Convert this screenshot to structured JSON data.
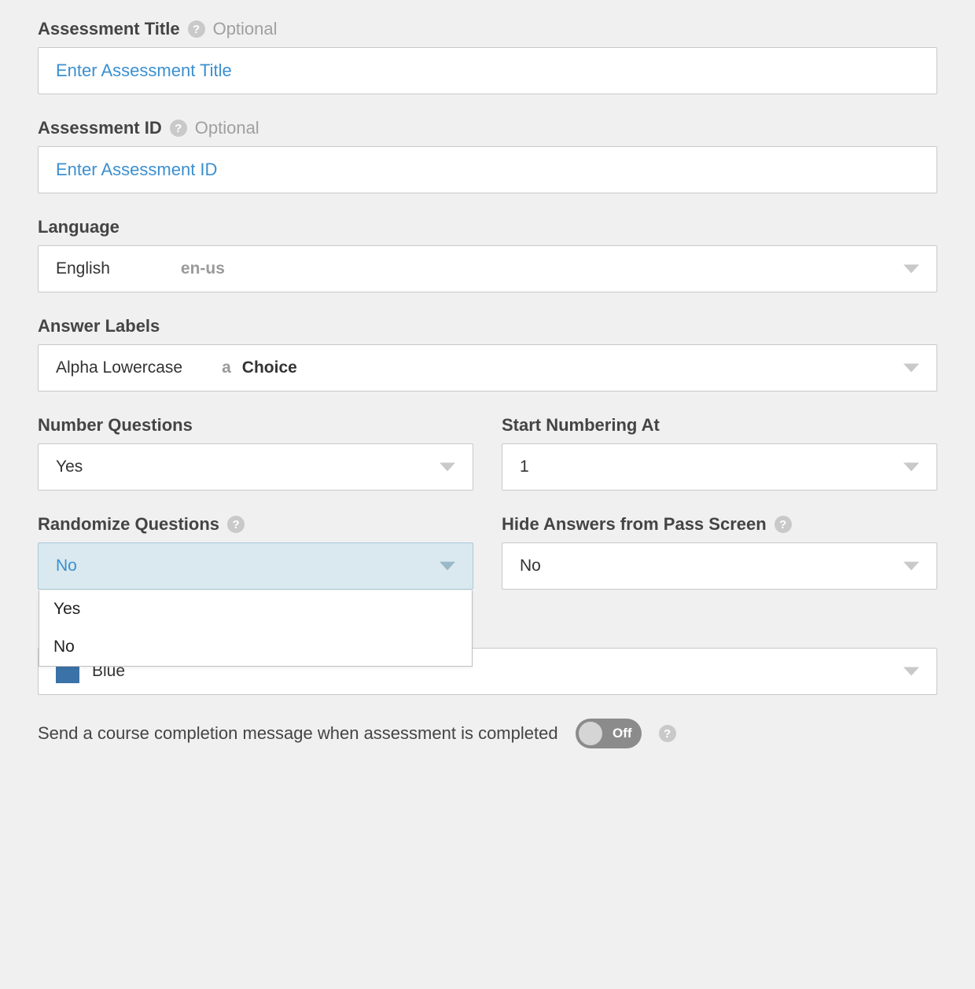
{
  "assessment_title": {
    "label": "Assessment Title",
    "optional": "Optional",
    "placeholder": "Enter Assessment Title",
    "value": ""
  },
  "assessment_id": {
    "label": "Assessment ID",
    "optional": "Optional",
    "placeholder": "Enter Assessment ID",
    "value": ""
  },
  "language": {
    "label": "Language",
    "value": "English",
    "code": "en-us"
  },
  "answer_labels": {
    "label": "Answer Labels",
    "value": "Alpha Lowercase",
    "prefix": "a",
    "suffix": "Choice"
  },
  "number_questions": {
    "label": "Number Questions",
    "value": "Yes"
  },
  "start_numbering": {
    "label": "Start Numbering At",
    "value": "1"
  },
  "randomize_questions": {
    "label": "Randomize Questions",
    "value": "No",
    "options": [
      "Yes",
      "No"
    ]
  },
  "hide_answers": {
    "label": "Hide Answers from Pass Screen",
    "value": "No"
  },
  "color_select": {
    "value": "Blue",
    "swatch": "#3b72a8"
  },
  "completion_toggle": {
    "label": "Send a course completion message when assessment is completed",
    "state": "Off"
  },
  "help_glyph": "?"
}
